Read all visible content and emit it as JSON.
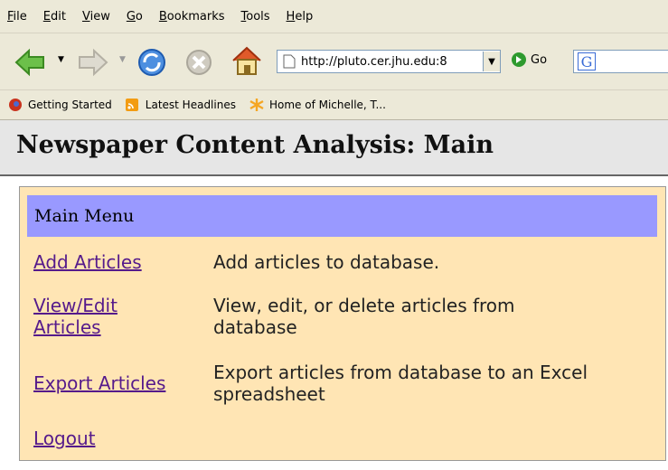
{
  "browser": {
    "menu": [
      {
        "prefix": "",
        "key": "F",
        "rest": "ile"
      },
      {
        "prefix": "",
        "key": "E",
        "rest": "dit"
      },
      {
        "prefix": "",
        "key": "V",
        "rest": "iew"
      },
      {
        "prefix": "",
        "key": "G",
        "rest": "o"
      },
      {
        "prefix": "",
        "key": "B",
        "rest": "ookmarks"
      },
      {
        "prefix": "",
        "key": "T",
        "rest": "ools"
      },
      {
        "prefix": "",
        "key": "H",
        "rest": "elp"
      }
    ],
    "url": "http://pluto.cer.jhu.edu:8",
    "go_label": "Go",
    "search_logo": "G",
    "bookmarks": [
      {
        "label": "Getting Started",
        "icon": "firefox-icon"
      },
      {
        "label": "Latest Headlines",
        "icon": "rss-icon"
      },
      {
        "label": "Home of Michelle, T...",
        "icon": "asterisk-icon"
      }
    ],
    "icons": {
      "back": "back-arrow-icon",
      "forward": "forward-arrow-icon",
      "reload": "reload-icon",
      "stop": "stop-icon",
      "home": "home-icon"
    },
    "colors": {
      "chrome": "#ece9d8",
      "go_green": "#2e9a2e"
    }
  },
  "page": {
    "title": "Newspaper Content Analysis: Main",
    "menu_header": "Main Menu",
    "items": [
      {
        "link": "Add Articles",
        "desc": "Add articles to database."
      },
      {
        "link": "View/Edit Articles",
        "desc": "View, edit, or delete articles from database"
      },
      {
        "link": "Export Articles",
        "desc": "Export articles from database to an Excel spreadsheet"
      },
      {
        "link": "Logout",
        "desc": ""
      }
    ],
    "colors": {
      "panel_bg": "#ffe5b4",
      "header_bg": "#9999ff",
      "link": "#551a8b"
    }
  }
}
